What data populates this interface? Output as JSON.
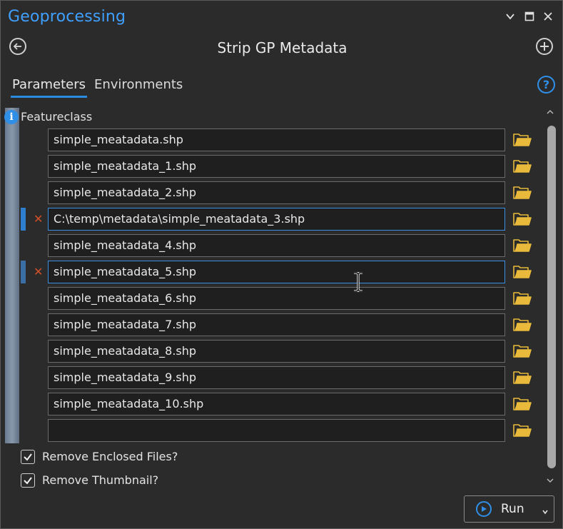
{
  "pane": {
    "title": "Geoprocessing",
    "tool_title": "Strip GP Metadata"
  },
  "tabs": [
    {
      "label": "Parameters",
      "active": true
    },
    {
      "label": "Environments",
      "active": false
    }
  ],
  "parameter": {
    "label": "Featureclass",
    "rows": [
      {
        "value": "simple_meatadata.shp",
        "state": "normal"
      },
      {
        "value": "simple_meatadata_1.shp",
        "state": "normal"
      },
      {
        "value": "simple_meatadata_2.shp",
        "state": "normal"
      },
      {
        "value": "C:\\temp\\metadata\\simple_meatadata_3.shp",
        "state": "focused"
      },
      {
        "value": "simple_meatadata_4.shp",
        "state": "normal"
      },
      {
        "value": "simple_meatadata_5.shp",
        "state": "hover"
      },
      {
        "value": "simple_meatadata_6.shp",
        "state": "normal"
      },
      {
        "value": "simple_meatadata_7.shp",
        "state": "normal"
      },
      {
        "value": "simple_meatadata_8.shp",
        "state": "normal"
      },
      {
        "value": "simple_meatadata_9.shp",
        "state": "normal"
      },
      {
        "value": "simple_meatadata_10.shp",
        "state": "normal"
      },
      {
        "value": "",
        "state": "normal"
      }
    ],
    "remove_symbol": "✕"
  },
  "options": [
    {
      "label": "Remove Enclosed Files?",
      "checked": true
    },
    {
      "label": "Remove Thumbnail?",
      "checked": true
    }
  ],
  "run_button": {
    "label": "Run"
  },
  "icons": {
    "back": "back-arrow-icon",
    "add": "add-icon",
    "help": "help-icon",
    "info": "info-icon",
    "folder": "folder-icon"
  },
  "colors": {
    "accent": "#2f8fe6",
    "title": "#3fa0ff",
    "remove": "#d25028",
    "folder": "#e8b93a",
    "background": "#2b2b2b",
    "field": "#1f1f1f"
  }
}
